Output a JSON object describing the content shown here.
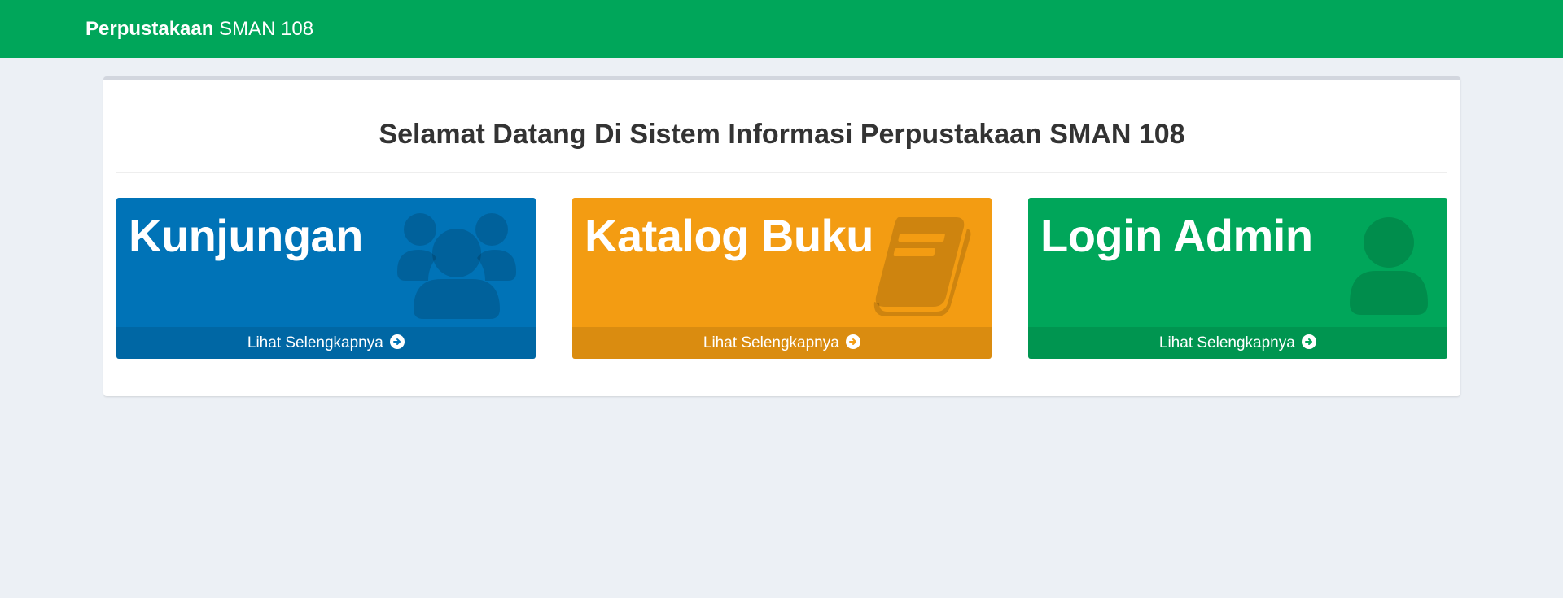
{
  "header": {
    "brand_bold": "Perpustakaan",
    "brand_rest": " SMAN 108",
    "color": "#00a65a"
  },
  "main": {
    "title": "Selamat Datang Di Sistem Informasi Perpustakaan SMAN 108",
    "tiles": [
      {
        "title": "Kunjungan",
        "link": "Lihat Selengkapnya",
        "color": "#0073b7",
        "icon": "users-icon"
      },
      {
        "title": "Katalog Buku",
        "link": "Lihat Selengkapnya",
        "color": "#f39c12",
        "icon": "book-icon"
      },
      {
        "title": "Login Admin",
        "link": "Lihat Selengkapnya",
        "color": "#00a65a",
        "icon": "user-icon"
      }
    ]
  }
}
